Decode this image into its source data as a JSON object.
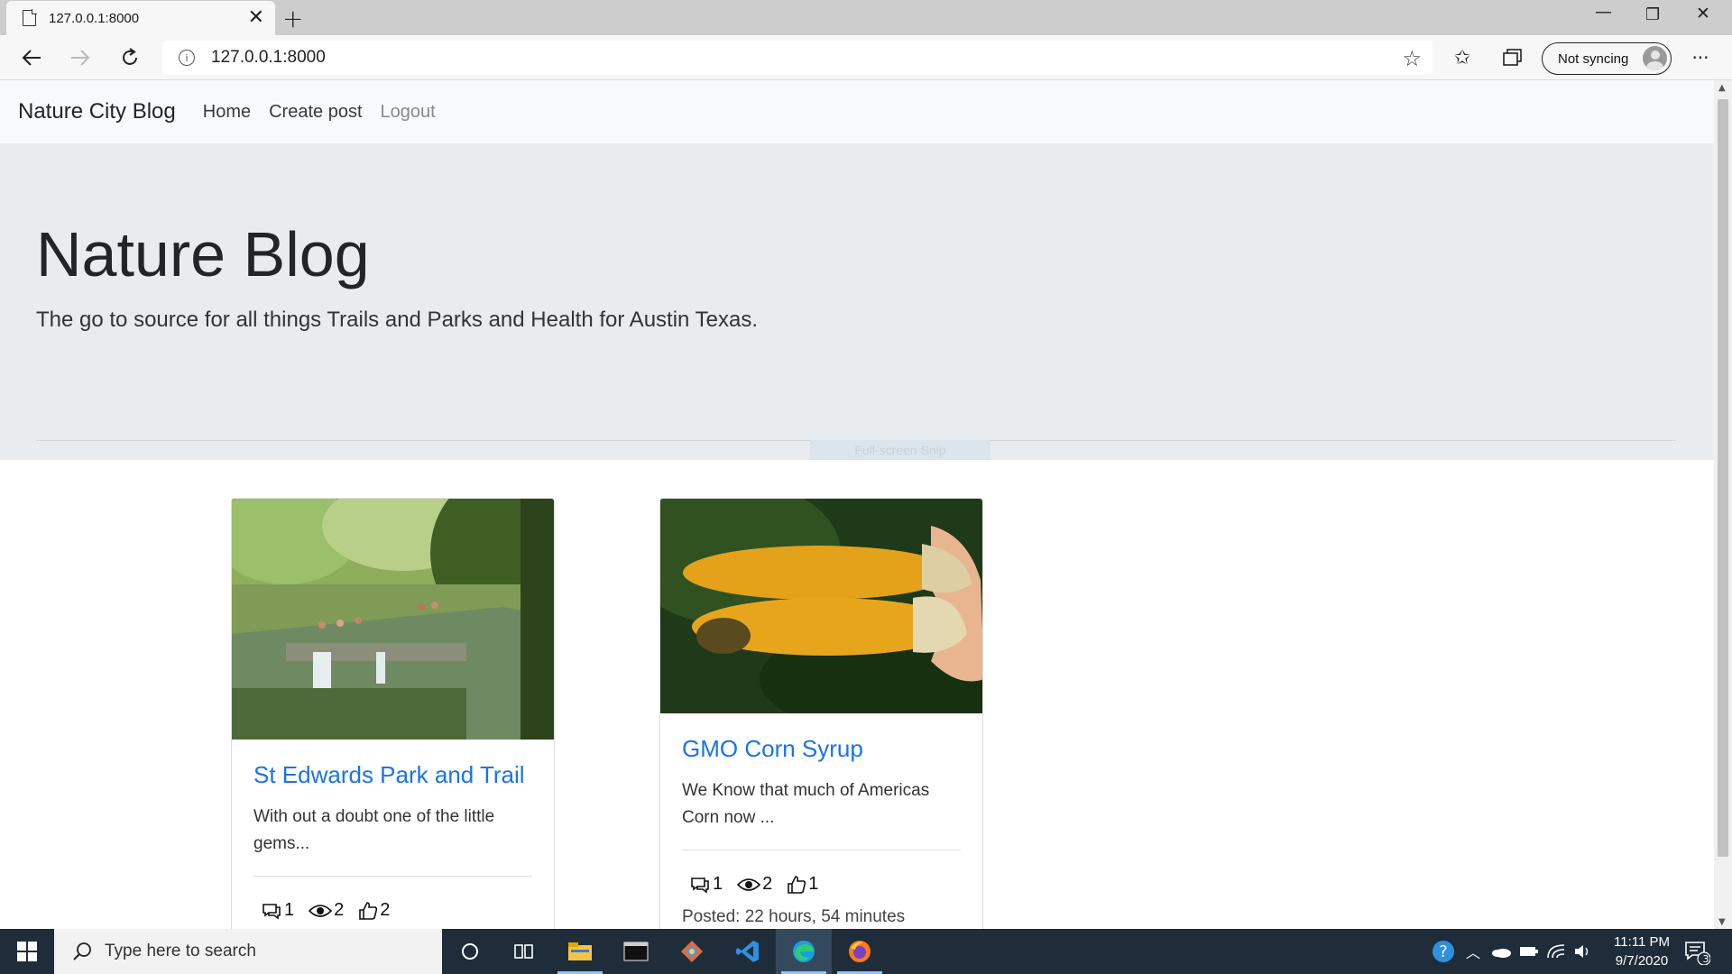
{
  "browser": {
    "tab_title": "127.0.0.1:8000",
    "url": "127.0.0.1:8000",
    "sync_label": "Not syncing"
  },
  "site": {
    "brand": "Nature City Blog",
    "nav": [
      "Home",
      "Create post",
      "Logout"
    ],
    "jumbotron": {
      "title": "Nature Blog",
      "subtitle": "The go to source for all things Trails and Parks and Health for Austin Texas.",
      "ghost_text": "Full-screen Snip"
    },
    "posts": [
      {
        "title": "St Edwards Park and Trail",
        "excerpt": "With out a doubt one of the little gems...",
        "comments": "1",
        "views": "2",
        "likes": "2",
        "image_icon": "park-waterfall-photo"
      },
      {
        "title": "GMO Corn Syrup",
        "excerpt": "We Know that much of Americas Corn now ...",
        "comments": "1",
        "views": "2",
        "likes": "1",
        "posted": "Posted: 22 hours, 54 minutes",
        "image_icon": "corn-photo"
      }
    ]
  },
  "taskbar": {
    "search_placeholder": "Type here to search",
    "time": "11:11 PM",
    "date": "9/7/2020",
    "notification_count": "3"
  },
  "colors": {
    "link_blue": "#1a73e8",
    "jumbotron_bg": "#e9ecef",
    "navbar_bg": "#f8f9fa",
    "taskbar_bg": "#1f2d3a"
  }
}
